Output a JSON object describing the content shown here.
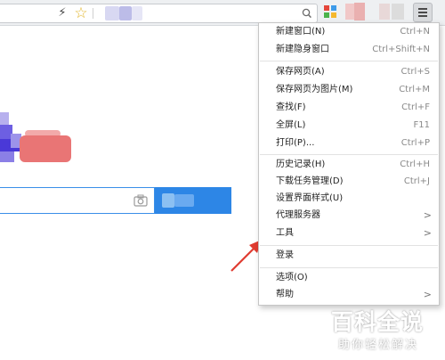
{
  "colors": {
    "menu_border": "#c6c6c6",
    "shortcut_text": "#8a8a8a",
    "search_border": "#3a8fe8",
    "search_button": "#2d86e6",
    "arrow": "#e03c31",
    "star": "#e2b52a"
  },
  "toolbar": {
    "icons": [
      "lightning-icon",
      "star-icon",
      "search-icon",
      "apps-icon",
      "menu-icon"
    ]
  },
  "menu": {
    "items": [
      {
        "label": "新建窗口(N)",
        "shortcut": "Ctrl+N"
      },
      {
        "label": "新建隐身窗口",
        "shortcut": "Ctrl+Shift+N"
      },
      {
        "label": "保存网页(A)",
        "shortcut": "Ctrl+S"
      },
      {
        "label": "保存网页为图片(M)",
        "shortcut": "Ctrl+M"
      },
      {
        "label": "查找(F)",
        "shortcut": "Ctrl+F"
      },
      {
        "label": "全屏(L)",
        "shortcut": "F11"
      },
      {
        "label": "打印(P)...",
        "shortcut": "Ctrl+P"
      },
      {
        "label": "历史记录(H)",
        "shortcut": "Ctrl+H"
      },
      {
        "label": "下载任务管理(D)",
        "shortcut": "Ctrl+J"
      },
      {
        "label": "设置界面样式(U)",
        "shortcut": ""
      },
      {
        "label": "代理服务器",
        "shortcut": ""
      },
      {
        "label": "工具",
        "shortcut": ""
      },
      {
        "label": "登录",
        "shortcut": ""
      },
      {
        "label": "选项(O)",
        "shortcut": ""
      },
      {
        "label": "帮助",
        "shortcut": ""
      }
    ]
  },
  "watermark": {
    "title": "百科全说",
    "subtitle": "助你轻松解决"
  }
}
